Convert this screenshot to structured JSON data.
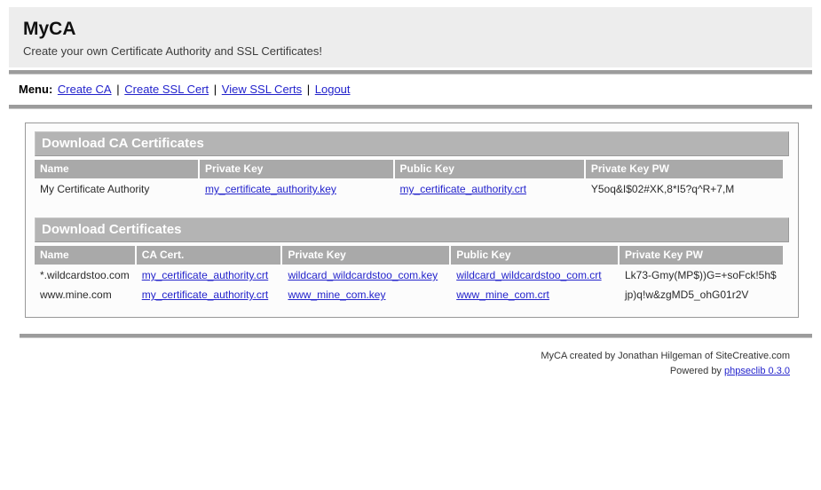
{
  "header": {
    "title": "MyCA",
    "subtitle": "Create your own Certificate Authority and SSL Certificates!"
  },
  "menu": {
    "label": "Menu:",
    "separator": "|",
    "items": [
      {
        "label": "Create CA"
      },
      {
        "label": "Create SSL Cert"
      },
      {
        "label": "View SSL Certs"
      },
      {
        "label": "Logout"
      }
    ]
  },
  "ca_table": {
    "title": "Download CA Certificates",
    "columns": [
      "Name",
      "Private Key",
      "Public Key",
      "Private Key PW"
    ],
    "rows": [
      {
        "name": "My Certificate Authority",
        "private_key": "my_certificate_authority.key",
        "public_key": "my_certificate_authority.crt",
        "private_key_pw": "Y5oq&I$02#XK,8*I5?q^R+7,M"
      }
    ]
  },
  "certs_table": {
    "title": "Download Certificates",
    "columns": [
      "Name",
      "CA Cert.",
      "Private Key",
      "Public Key",
      "Private Key PW"
    ],
    "rows": [
      {
        "name": "*.wildcardstoo.com",
        "ca_cert": "my_certificate_authority.crt",
        "private_key": "wildcard_wildcardstoo_com.key",
        "public_key": "wildcard_wildcardstoo_com.crt",
        "private_key_pw": "Lk73-Gmy(MP$))G=+soFck!5h$"
      },
      {
        "name": "www.mine.com",
        "ca_cert": "my_certificate_authority.crt",
        "private_key": "www_mine_com.key",
        "public_key": "www_mine_com.crt",
        "private_key_pw": "jp)q!w&zgMD5_ohG01r2V"
      }
    ]
  },
  "footer": {
    "credit": "MyCA created by Jonathan Hilgeman of SiteCreative.com",
    "powered_by_prefix": "Powered by ",
    "powered_by_link": "phpseclib 0.3.0"
  },
  "colors": {
    "link": "#2323cc",
    "divider_bar": "#9c9c9c",
    "section_title_bg": "#b4b4b4",
    "column_header_bg": "#a9a9a9",
    "header_bg": "#ededed"
  }
}
